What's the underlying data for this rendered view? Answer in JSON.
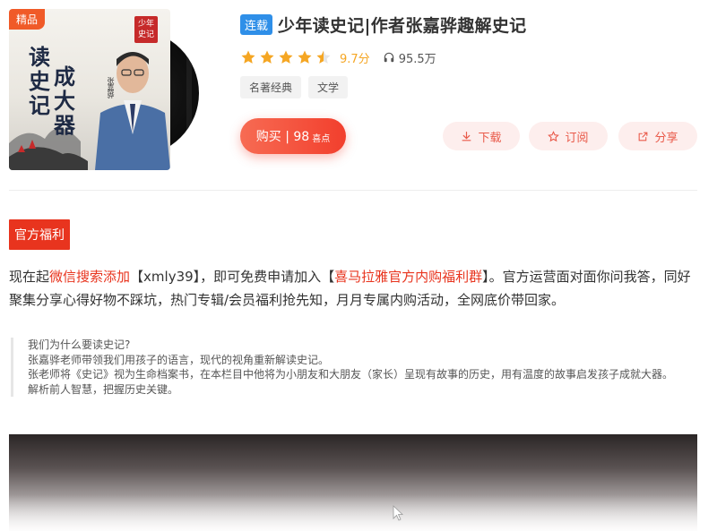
{
  "album": {
    "badge": "精品",
    "status_tag": "连载",
    "title": "少年读史记|作者张嘉骅趣解史记",
    "score": "9.7分",
    "play_count": "95.5万",
    "rating_stars": 4.5,
    "tags": [
      "名著经典",
      "文学"
    ],
    "cover": {
      "title_col1": "读史记",
      "title_col2": "成大器",
      "author": "张嘉骅"
    }
  },
  "actions": {
    "buy_label": "购买 | 98",
    "buy_unit": "喜点",
    "download_label": "下载",
    "subscribe_label": "订阅",
    "share_label": "分享"
  },
  "intro": {
    "benefit_tag": "官方福利",
    "para_1": "现在起",
    "para_link_1": "微信搜索添加",
    "para_2": "【xmly39】，即可免费申请加入【",
    "para_link_2": "喜马拉雅官方内购福利群",
    "para_3": "】。官方运营面对面你问我答，同好聚集分享心得好物不踩坑，热门专辑/会员福利抢先知，月月专属内购活动，全网底价带回家。",
    "quote_lines": [
      "我们为什么要读史记?",
      "张嘉骅老师带领我们用孩子的语言，现代的视角重新解读史记。",
      "张老师将《史记》视为生命档案书，在本栏目中他将为小朋友和大朋友（家长）呈现有故事的历史，用有温度的故事启发孩子成就大器。",
      "解析前人智慧，把握历史关键。"
    ]
  },
  "colors": {
    "accent_red": "#e8341e",
    "star": "#f5a623",
    "status_blue": "#2f8fe8",
    "action_bg": "#fdeeed"
  },
  "icons": [
    "star-icon",
    "half-star-icon",
    "headphone-icon",
    "download-icon",
    "star-outline-icon",
    "share-icon"
  ]
}
